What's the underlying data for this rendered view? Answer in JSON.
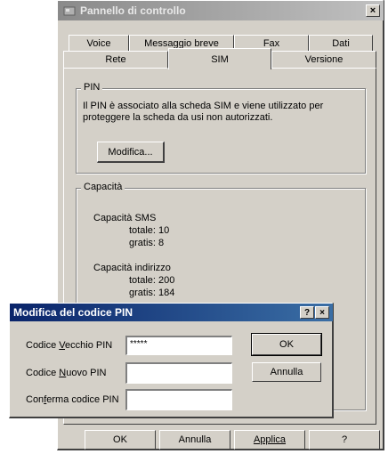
{
  "main_window": {
    "title": "Pannello di controllo",
    "close_glyph": "×",
    "tabs_row1": [
      "Voice",
      "Messaggio breve",
      "Fax",
      "Dati"
    ],
    "tabs_row2": [
      "Rete",
      "SIM",
      "Versione"
    ],
    "pin_group": {
      "label": "PIN",
      "description_line1": "Il PIN è associato alla scheda SIM e viene utilizzato per",
      "description_line2": "proteggere la scheda da usi non autorizzati.",
      "modify_button": "Modifica..."
    },
    "capacity_group": {
      "label": "Capacità",
      "sms_title": "Capacità SMS",
      "sms_total": "totale: 10",
      "sms_free": "gratis: 8",
      "addr_title": "Capacità indirizzo",
      "addr_total": "totale: 200",
      "addr_free": "gratis: 184"
    },
    "buttons": [
      "OK",
      "Annulla",
      "Applica",
      "?"
    ]
  },
  "pin_dialog": {
    "title": "Modifica del codice PIN",
    "help_glyph": "?",
    "close_glyph": "×",
    "old_pin": {
      "label_pre": "Codice ",
      "label_u": "V",
      "label_post": "ecchio PIN",
      "value": "*****"
    },
    "new_pin": {
      "label_pre": "Codice ",
      "label_u": "N",
      "label_post": "uovo PIN",
      "value": ""
    },
    "confirm_pin": {
      "label_pre": "Con",
      "label_u": "f",
      "label_post": "erma codice PIN",
      "value": ""
    },
    "ok_button": "OK",
    "cancel_button": "Annulla"
  }
}
